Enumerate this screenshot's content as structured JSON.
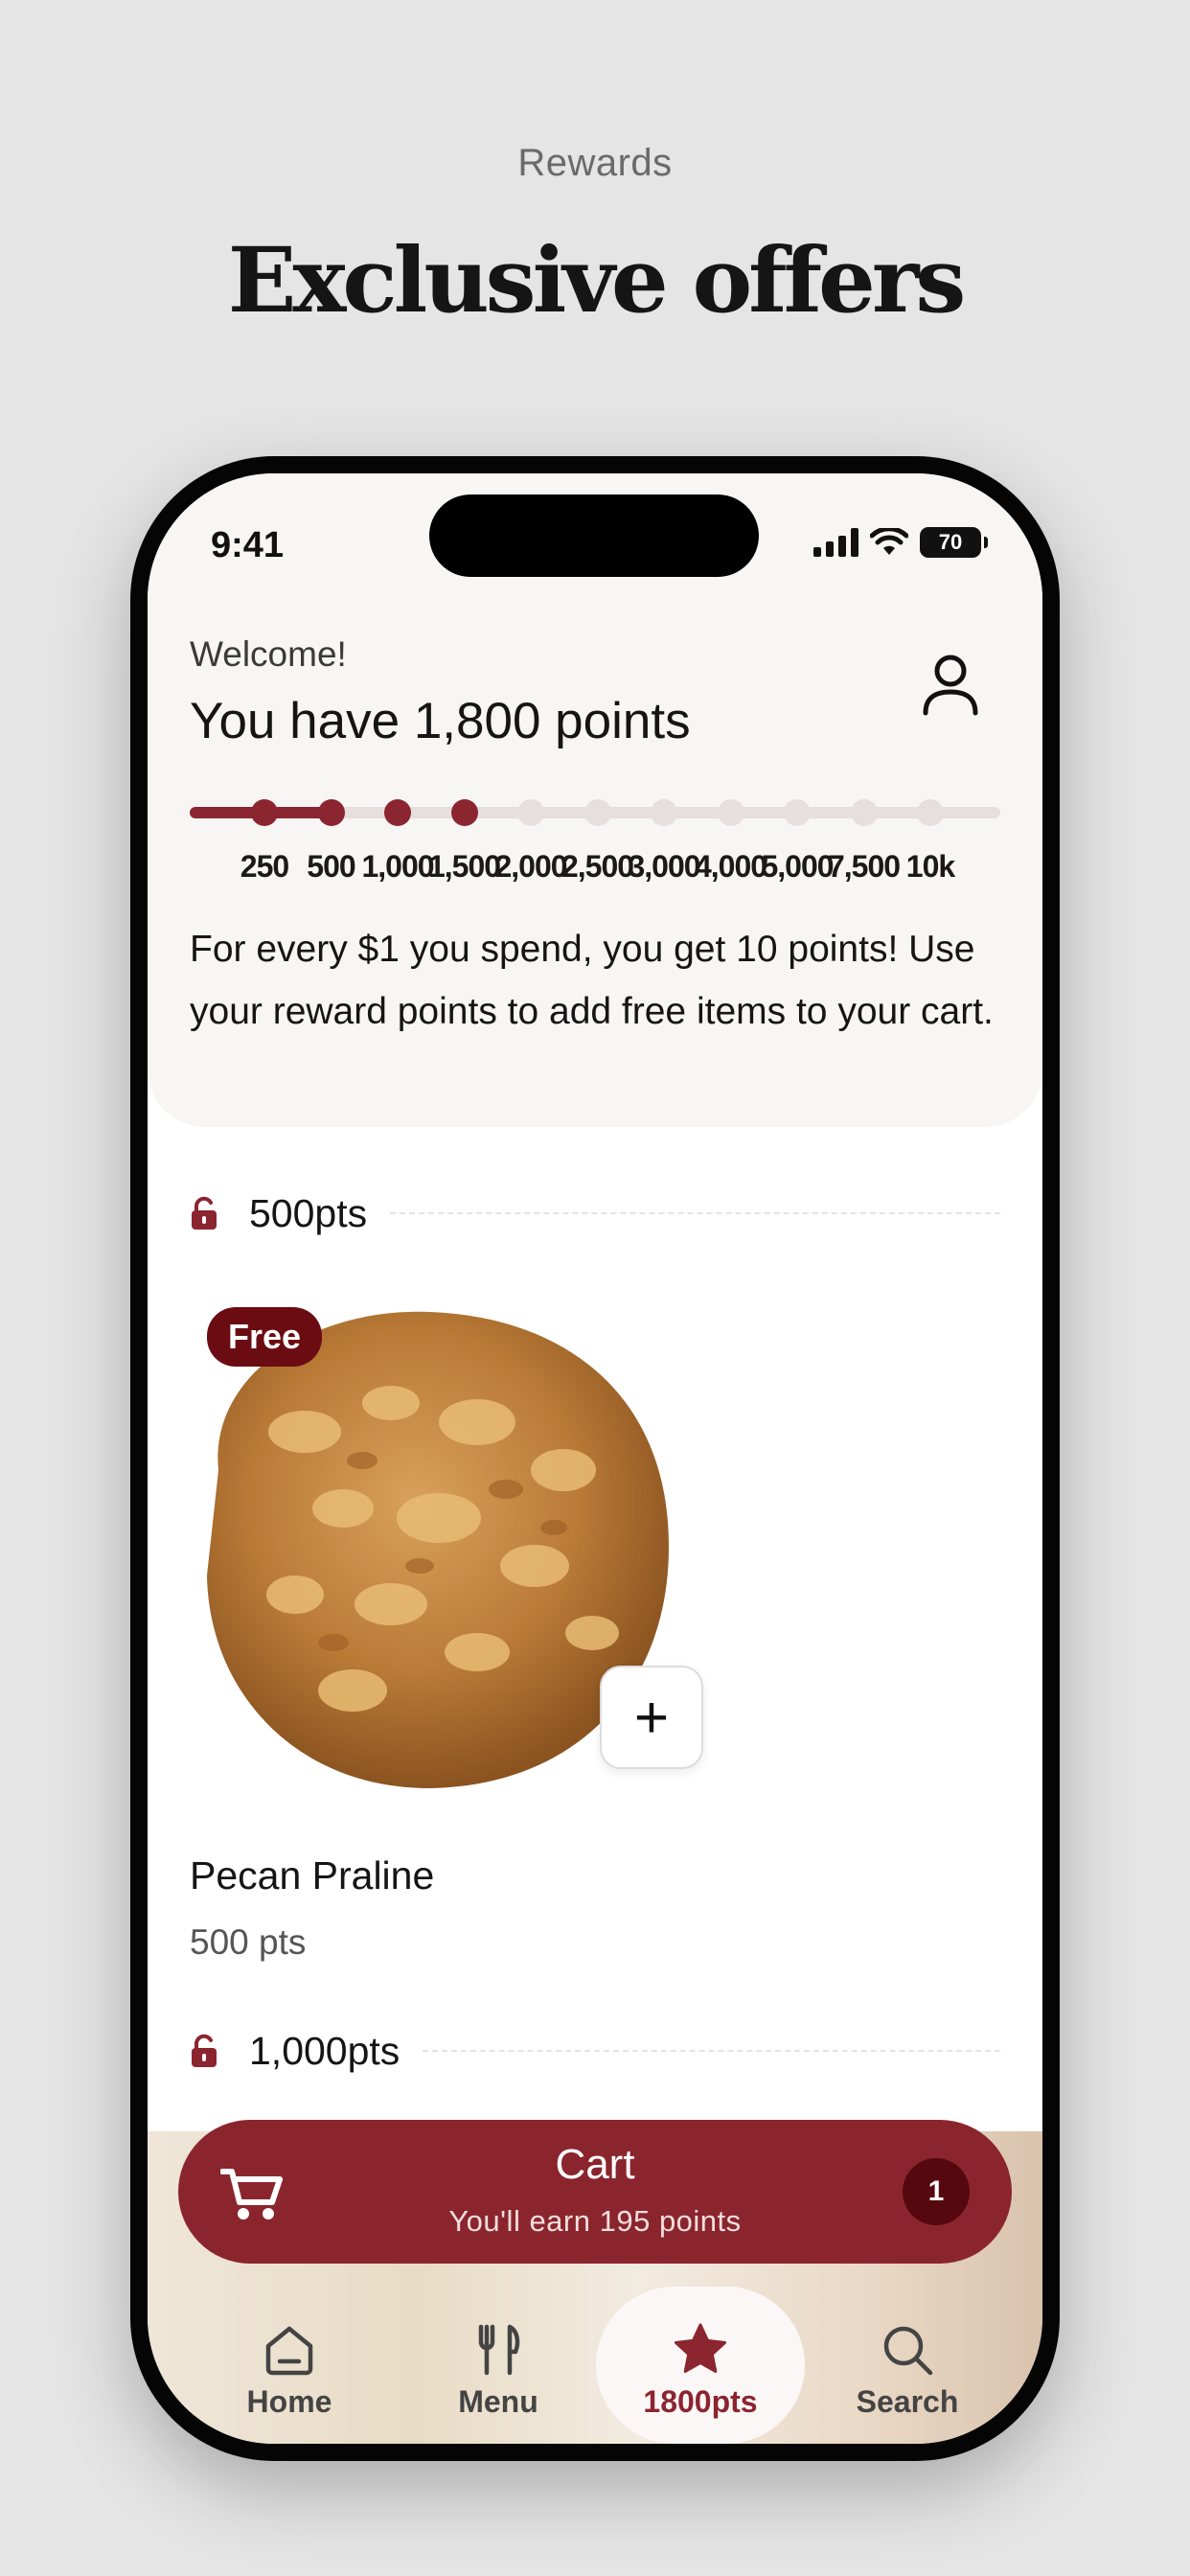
{
  "page": {
    "eyebrow": "Rewards",
    "title": "Exclusive offers"
  },
  "status_bar": {
    "time": "9:41",
    "battery": "70"
  },
  "header": {
    "welcome": "Welcome!",
    "points_title": "You have 1,800 points",
    "progress": {
      "current_points": 1800,
      "tiers": [
        "250",
        "500",
        "1,000",
        "1,500",
        "2,000",
        "2,500",
        "3,000",
        "4,000",
        "5,000",
        "7,500",
        "10k"
      ],
      "tiers_reached": 4
    },
    "blurb": "For every $1 you spend, you get 10 points! Use your reward points to add free items to your cart."
  },
  "sections": [
    {
      "label": "500pts",
      "icon": "unlocked-lock-icon",
      "items": [
        {
          "badge": "Free",
          "name": "Pecan Praline",
          "points": "500 pts",
          "add_label": "+"
        }
      ]
    },
    {
      "label": "1,000pts",
      "icon": "unlocked-lock-icon"
    }
  ],
  "cart": {
    "title": "Cart",
    "subtitle": "You'll earn 195 points",
    "count": "1"
  },
  "nav": {
    "items": [
      {
        "label": "Home",
        "icon": "home-icon"
      },
      {
        "label": "Menu",
        "icon": "utensils-icon"
      },
      {
        "label": "1800pts",
        "icon": "star-icon",
        "active": true
      },
      {
        "label": "Search",
        "icon": "search-icon"
      }
    ]
  },
  "colors": {
    "accent": "#8b2530",
    "badge": "#6b0c12",
    "background": "#e5e5e6"
  }
}
